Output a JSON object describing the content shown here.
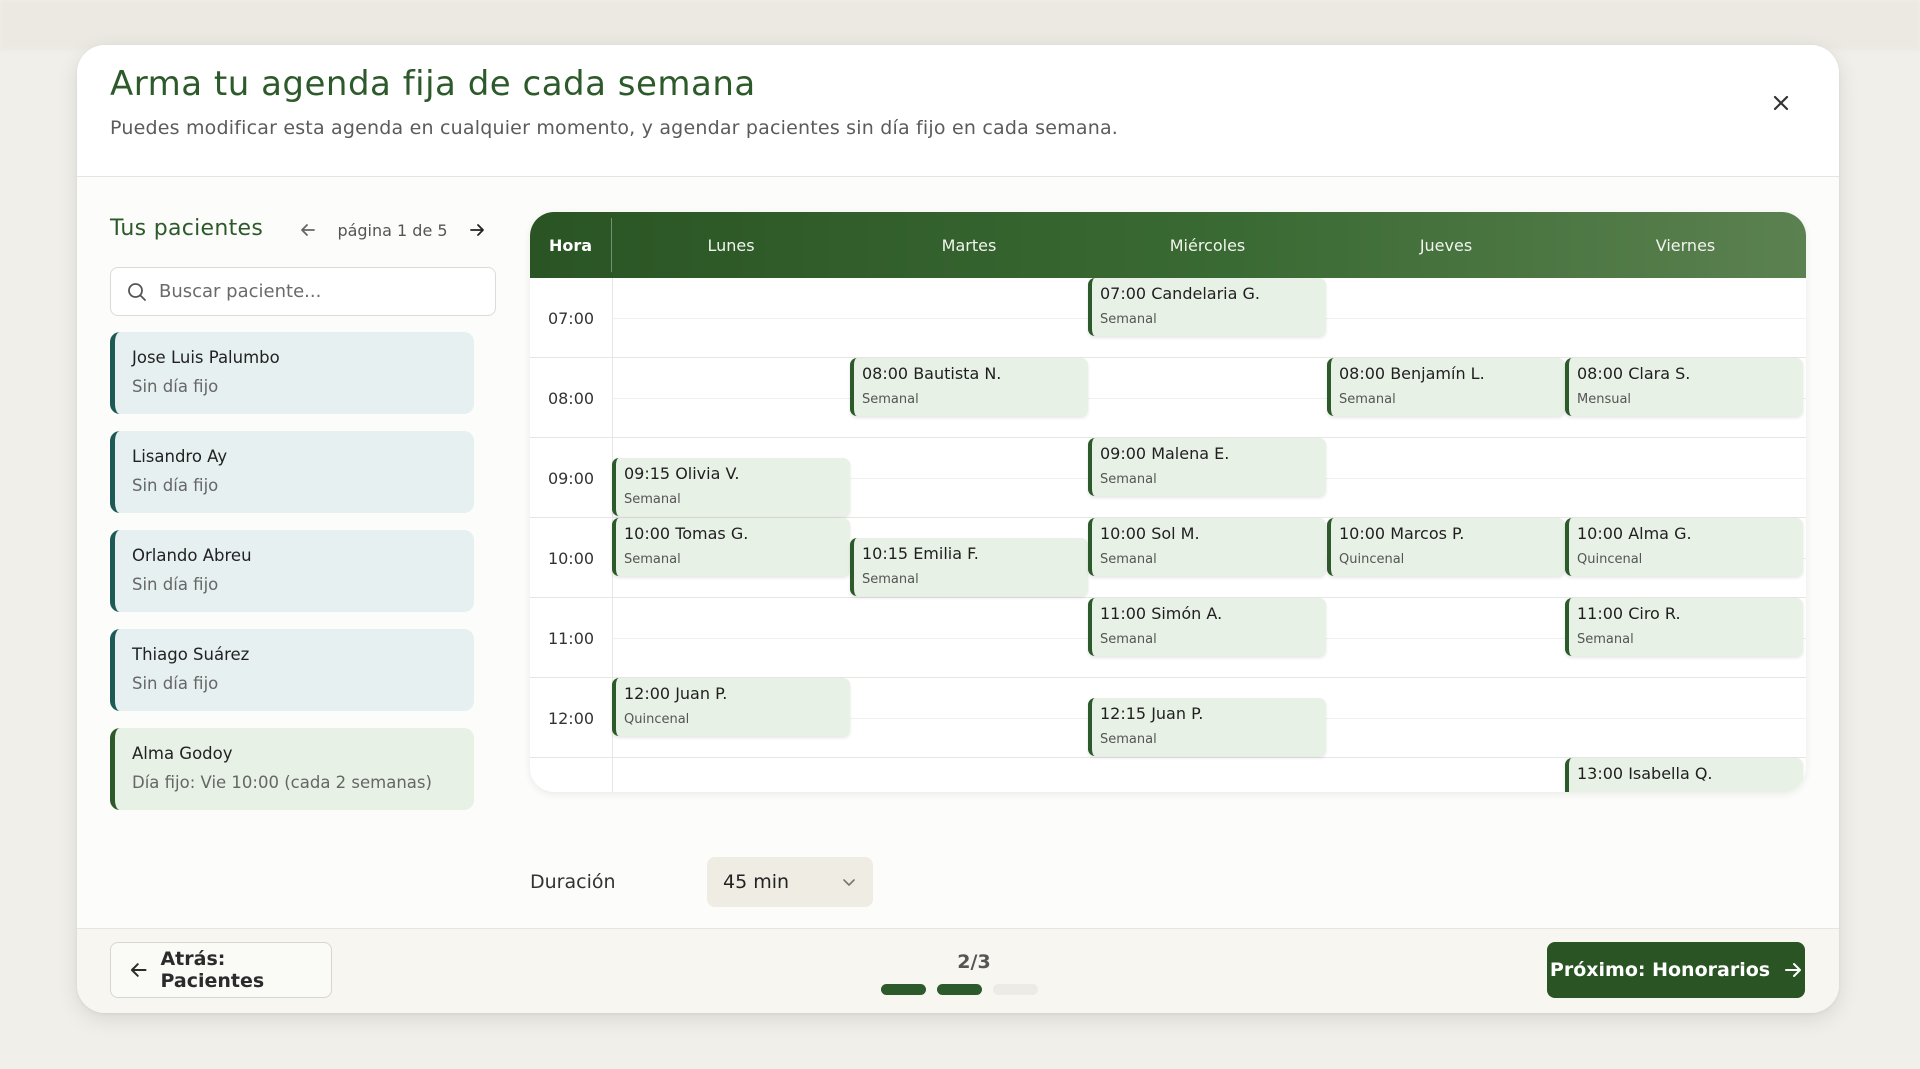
{
  "modal": {
    "title": "Arma tu agenda fija de cada semana",
    "subtitle": "Puedes modificar esta agenda en cualquier momento, y agendar pacientes sin día fijo en cada semana."
  },
  "patients": {
    "title": "Tus pacientes",
    "pager_text": "página 1 de 5",
    "search_placeholder": "Buscar paciente...",
    "items": [
      {
        "name": "Jose Luis Palumbo",
        "status": "Sin día fijo"
      },
      {
        "name": "Lisandro Ay",
        "status": "Sin día fijo"
      },
      {
        "name": "Orlando Abreu",
        "status": "Sin día fijo"
      },
      {
        "name": "Thiago Suárez",
        "status": "Sin día fijo"
      },
      {
        "name": "Alma Godoy",
        "status": "Día fijo: Vie 10:00 (cada 2 semanas)"
      }
    ]
  },
  "calendar": {
    "hour_header": "Hora",
    "days": [
      "Lunes",
      "Martes",
      "Miércoles",
      "Jueves",
      "Viernes"
    ],
    "hours": [
      "07:00",
      "08:00",
      "09:00",
      "10:00",
      "11:00",
      "12:00"
    ],
    "appointments": [
      {
        "title": "07:00 Candelaria G.",
        "freq": "Semanal"
      },
      {
        "title": "08:00 Bautista N.",
        "freq": "Semanal"
      },
      {
        "title": "08:00 Benjamín L.",
        "freq": "Semanal"
      },
      {
        "title": "08:00 Clara S.",
        "freq": "Mensual"
      },
      {
        "title": "09:15 Olivia V.",
        "freq": "Semanal"
      },
      {
        "title": "09:00 Malena E.",
        "freq": "Semanal"
      },
      {
        "title": "10:00 Tomas G.",
        "freq": "Semanal"
      },
      {
        "title": "10:15 Emilia F.",
        "freq": "Semanal"
      },
      {
        "title": "10:00 Sol M.",
        "freq": "Semanal"
      },
      {
        "title": "10:00 Marcos P.",
        "freq": "Quincenal"
      },
      {
        "title": "10:00 Alma G.",
        "freq": "Quincenal"
      },
      {
        "title": "11:00 Simón A.",
        "freq": "Semanal"
      },
      {
        "title": "11:00 Ciro R.",
        "freq": "Semanal"
      },
      {
        "title": "12:00 Juan P.",
        "freq": "Quincenal"
      },
      {
        "title": "12:15 Juan P.",
        "freq": "Semanal"
      },
      {
        "title": "13:00 Isabella Q.",
        "freq": ""
      }
    ]
  },
  "duration": {
    "label": "Duración",
    "value": "45 min"
  },
  "footer": {
    "back_label": "Atrás: Pacientes",
    "step": "2/3",
    "next_label": "Próximo: Honorarios"
  },
  "colors": {
    "brand_green": "#2a5424",
    "unscheduled_card": "#e6f0f0",
    "scheduled_card": "#e8f1e6"
  }
}
